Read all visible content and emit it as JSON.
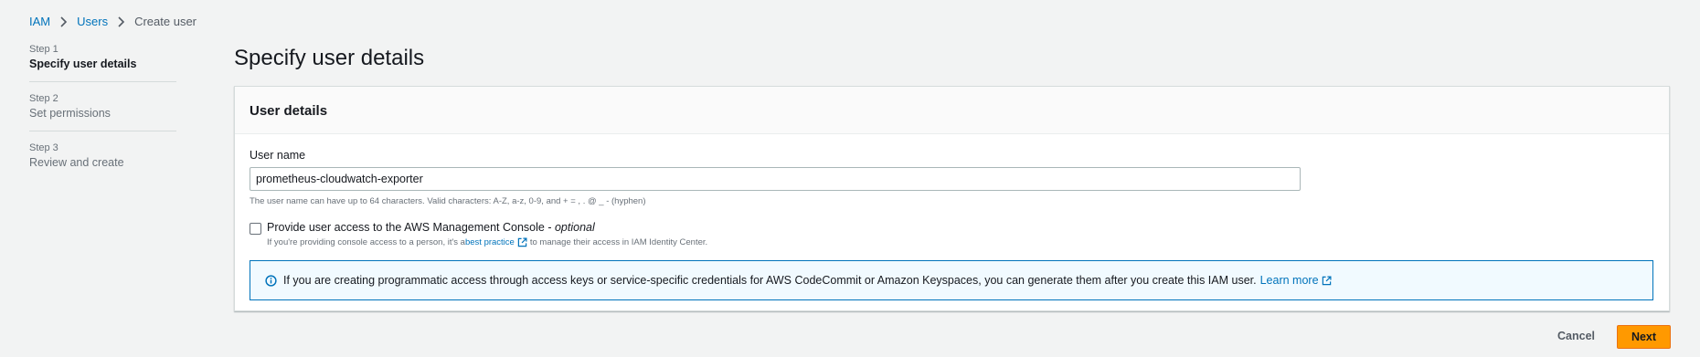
{
  "breadcrumb": {
    "items": [
      {
        "label": "IAM"
      },
      {
        "label": "Users"
      }
    ],
    "current": "Create user"
  },
  "steps": [
    {
      "number": "Step 1",
      "label": "Specify user details",
      "active": true
    },
    {
      "number": "Step 2",
      "label": "Set permissions",
      "active": false
    },
    {
      "number": "Step 3",
      "label": "Review and create",
      "active": false
    }
  ],
  "page": {
    "title": "Specify user details"
  },
  "user_details": {
    "title": "User details",
    "username": {
      "label": "User name",
      "value": "prometheus-cloudwatch-exporter",
      "hint": "The user name can have up to 64 characters. Valid characters: A-Z, a-z, 0-9, and + = , . @ _ - (hyphen)"
    },
    "console_access": {
      "label": "Provide user access to the AWS Management Console - ",
      "optional": "optional",
      "checked": false,
      "desc_before": "If you're providing console access to a person, it's a ",
      "desc_link": "best practice",
      "desc_after": " to manage their access in IAM Identity Center."
    },
    "info": {
      "text": "If you are creating programmatic access through access keys or service-specific credentials for AWS CodeCommit or Amazon Keyspaces, you can generate them after you create this IAM user.",
      "link": "Learn more"
    }
  },
  "actions": {
    "cancel": "Cancel",
    "next": "Next"
  },
  "colors": {
    "link": "#0073bb",
    "primary_button": "#ff9900",
    "info_border": "#0073bb",
    "info_background": "#f1faff"
  },
  "icons": {
    "breadcrumb_separator": "chevron-right-icon",
    "info": "info-icon",
    "external_link": "external-link-icon"
  }
}
